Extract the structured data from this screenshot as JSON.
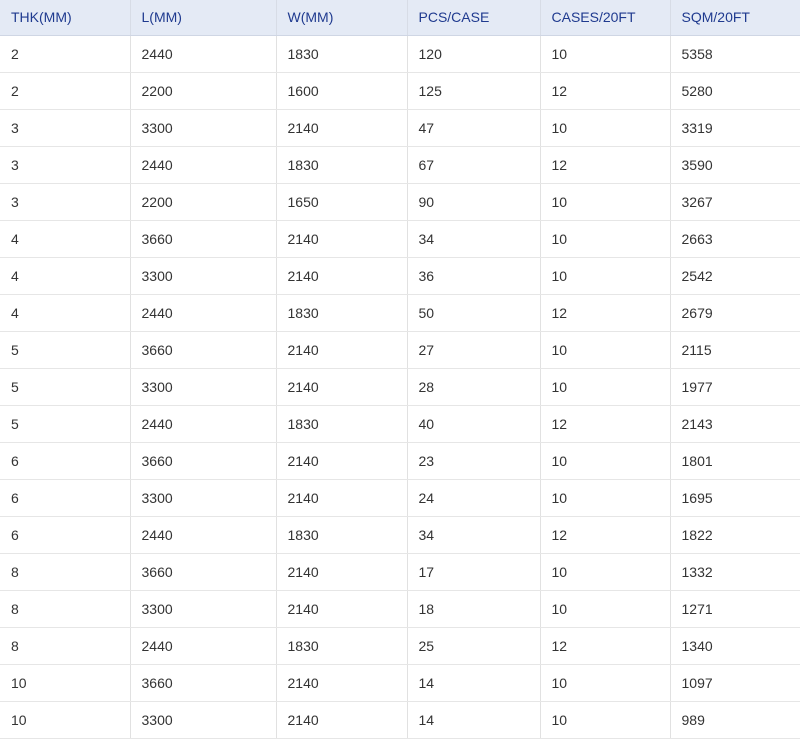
{
  "table": {
    "headers": [
      "THK(MM)",
      "L(MM)",
      "W(MM)",
      "PCS/CASE",
      "CASES/20FT",
      "SQM/20FT"
    ],
    "rows": [
      [
        "2",
        "2440",
        "1830",
        "120",
        "10",
        "5358"
      ],
      [
        "2",
        "2200",
        "1600",
        "125",
        "12",
        "5280"
      ],
      [
        "3",
        "3300",
        "2140",
        "47",
        "10",
        "3319"
      ],
      [
        "3",
        "2440",
        "1830",
        "67",
        "12",
        "3590"
      ],
      [
        "3",
        "2200",
        "1650",
        "90",
        "10",
        "3267"
      ],
      [
        "4",
        "3660",
        "2140",
        "34",
        "10",
        "2663"
      ],
      [
        "4",
        "3300",
        "2140",
        "36",
        "10",
        "2542"
      ],
      [
        "4",
        "2440",
        "1830",
        "50",
        "12",
        "2679"
      ],
      [
        "5",
        "3660",
        "2140",
        "27",
        "10",
        "2115"
      ],
      [
        "5",
        "3300",
        "2140",
        "28",
        "10",
        "1977"
      ],
      [
        "5",
        "2440",
        "1830",
        "40",
        "12",
        "2143"
      ],
      [
        "6",
        "3660",
        "2140",
        "23",
        "10",
        "1801"
      ],
      [
        "6",
        "3300",
        "2140",
        "24",
        "10",
        "1695"
      ],
      [
        "6",
        "2440",
        "1830",
        "34",
        "12",
        "1822"
      ],
      [
        "8",
        "3660",
        "2140",
        "17",
        "10",
        "1332"
      ],
      [
        "8",
        "3300",
        "2140",
        "18",
        "10",
        "1271"
      ],
      [
        "8",
        "2440",
        "1830",
        "25",
        "12",
        "1340"
      ],
      [
        "10",
        "3660",
        "2140",
        "14",
        "10",
        "1097"
      ],
      [
        "10",
        "3300",
        "2140",
        "14",
        "10",
        "989"
      ]
    ]
  },
  "colors": {
    "header_background": "#e4eaf5",
    "header_text": "#1f3a8f",
    "cell_text": "#333333",
    "grid_line": "#e1e1e1"
  }
}
